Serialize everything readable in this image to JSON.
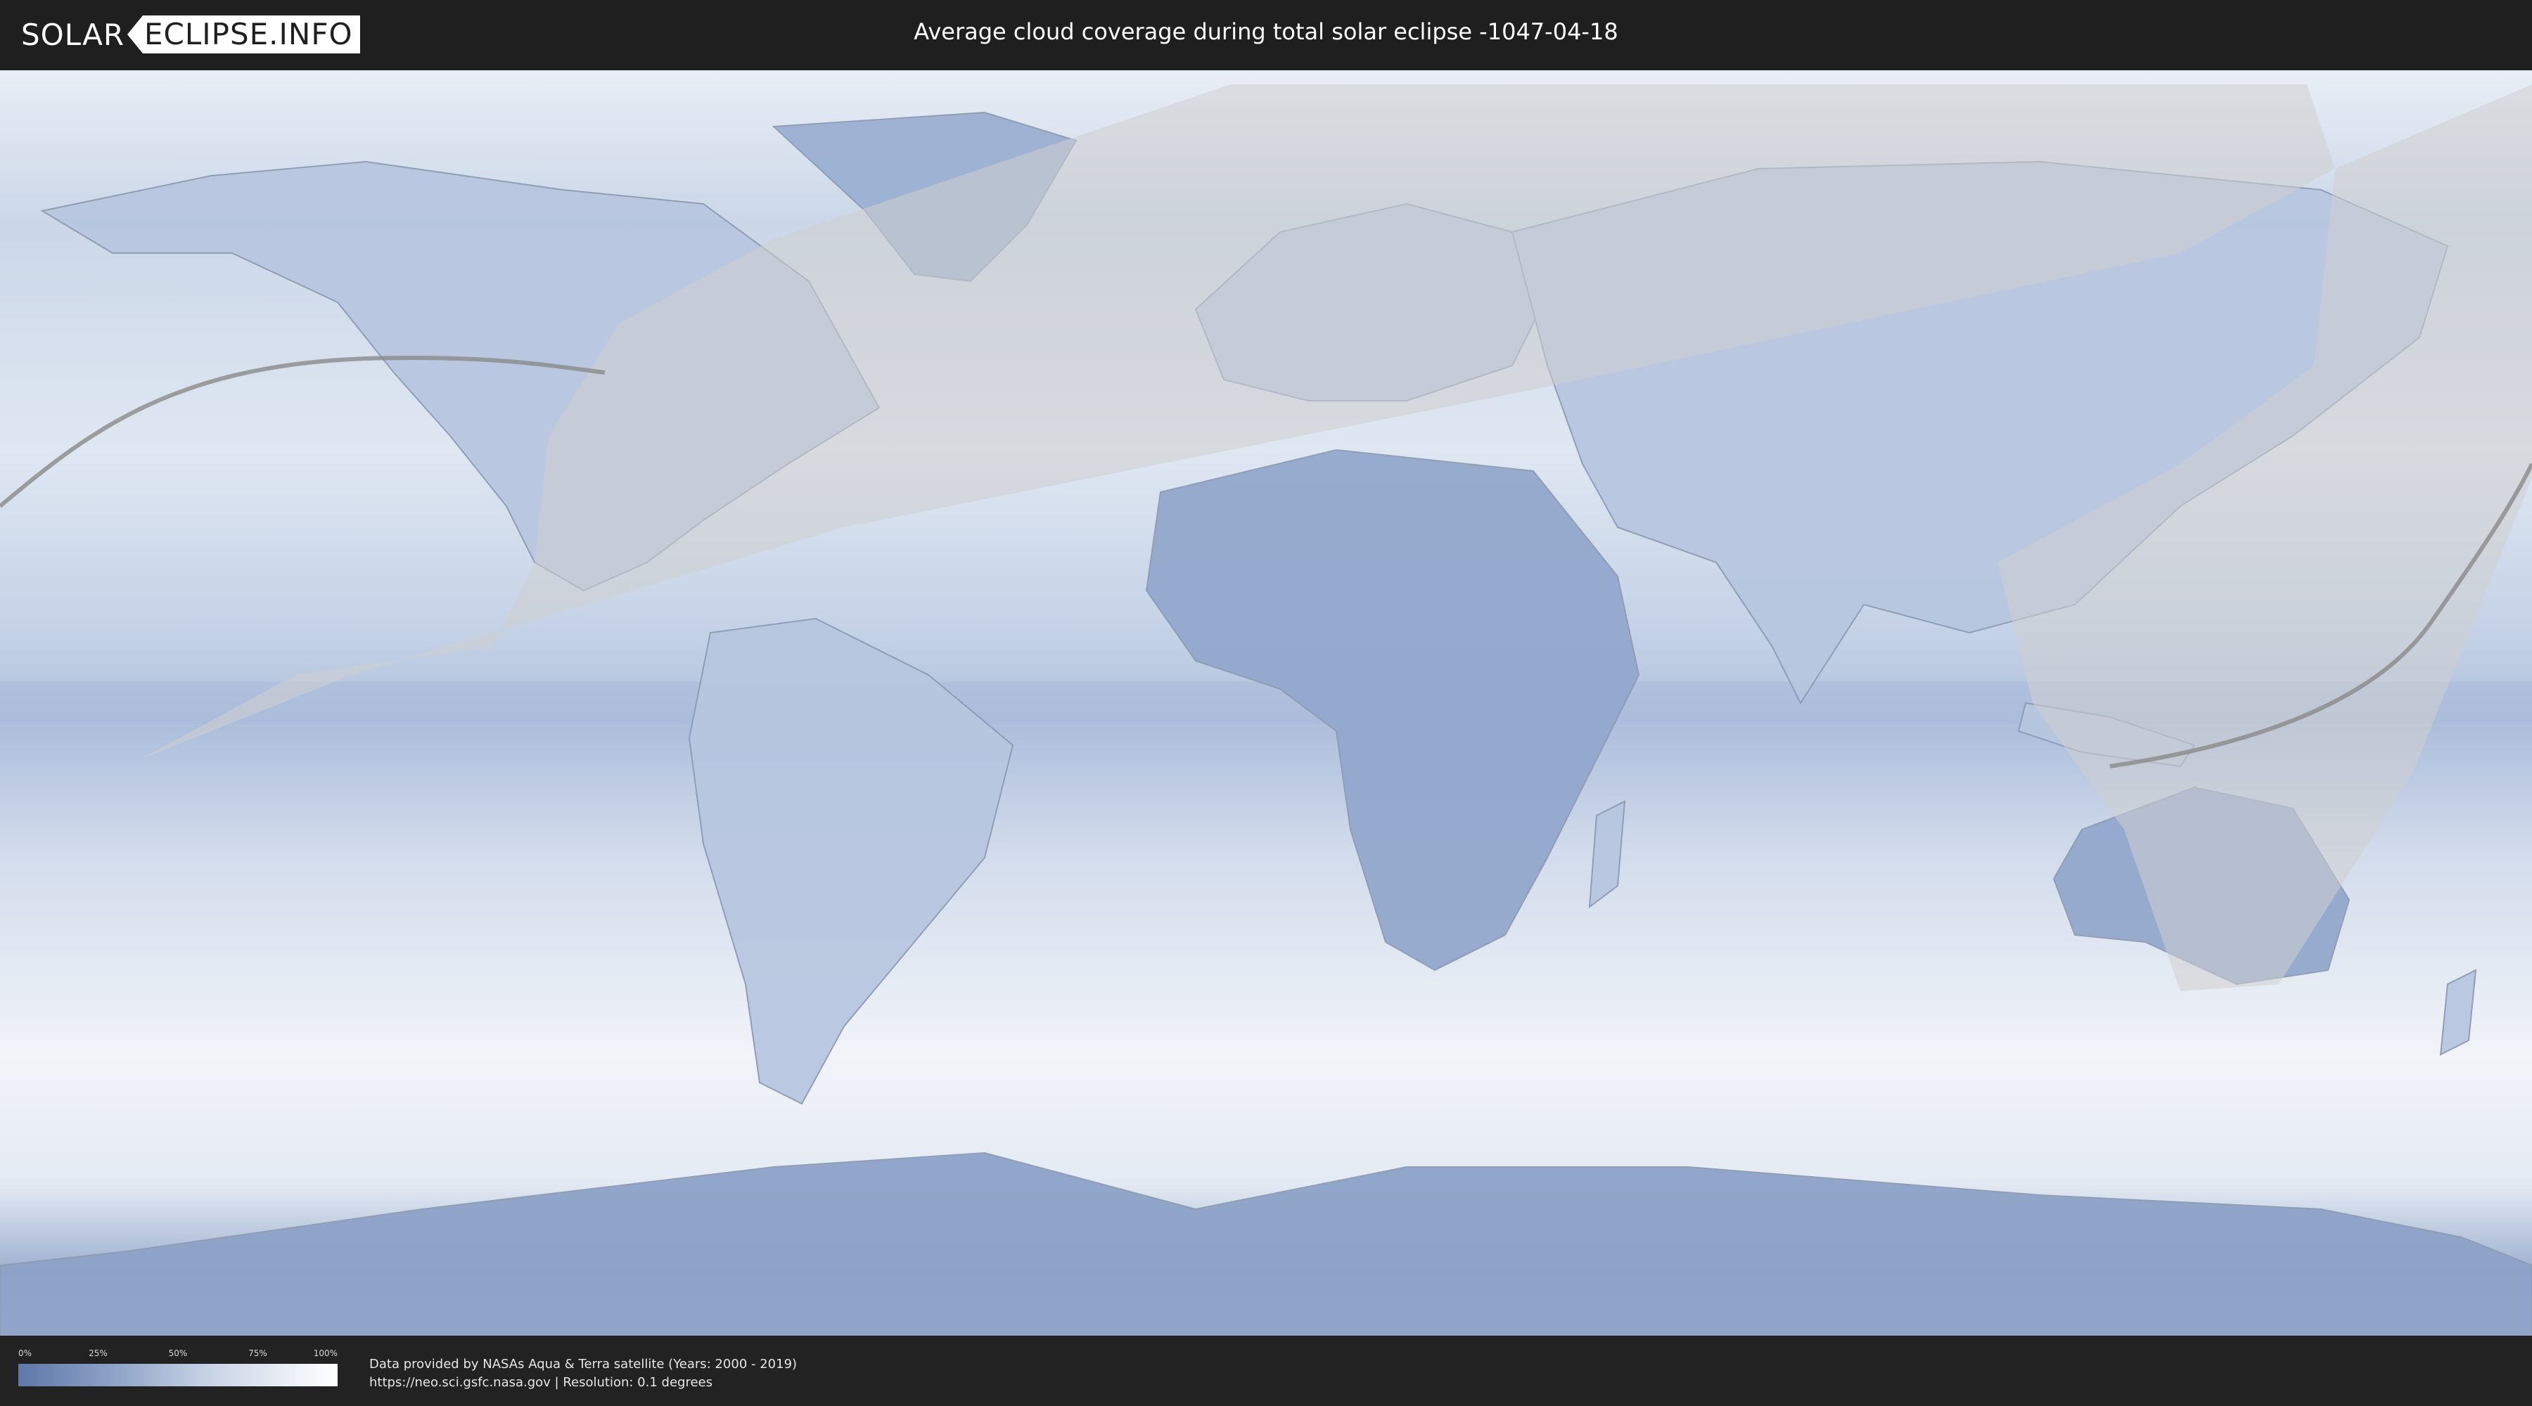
{
  "header": {
    "logo_left": "SOLAR",
    "logo_right": "ECLIPSE.INFO",
    "title": "Average cloud coverage during total solar eclipse -1047-04-18"
  },
  "map": {
    "background_color": "#eef2f8",
    "cloud_clear_color": "#5e78a8",
    "cloud_full_color": "#ffffff",
    "shadow_overlay_color": "#cfcfcf",
    "eclipse_path_color": "#8a8a8a"
  },
  "legend": {
    "ticks": [
      "0%",
      "25%",
      "50%",
      "75%",
      "100%"
    ]
  },
  "credits": {
    "line1": "Data provided by NASAs Aqua & Terra satellite (Years: 2000 - 2019)",
    "line2": "https://neo.sci.gsfc.nasa.gov | Resolution: 0.1 degrees"
  }
}
